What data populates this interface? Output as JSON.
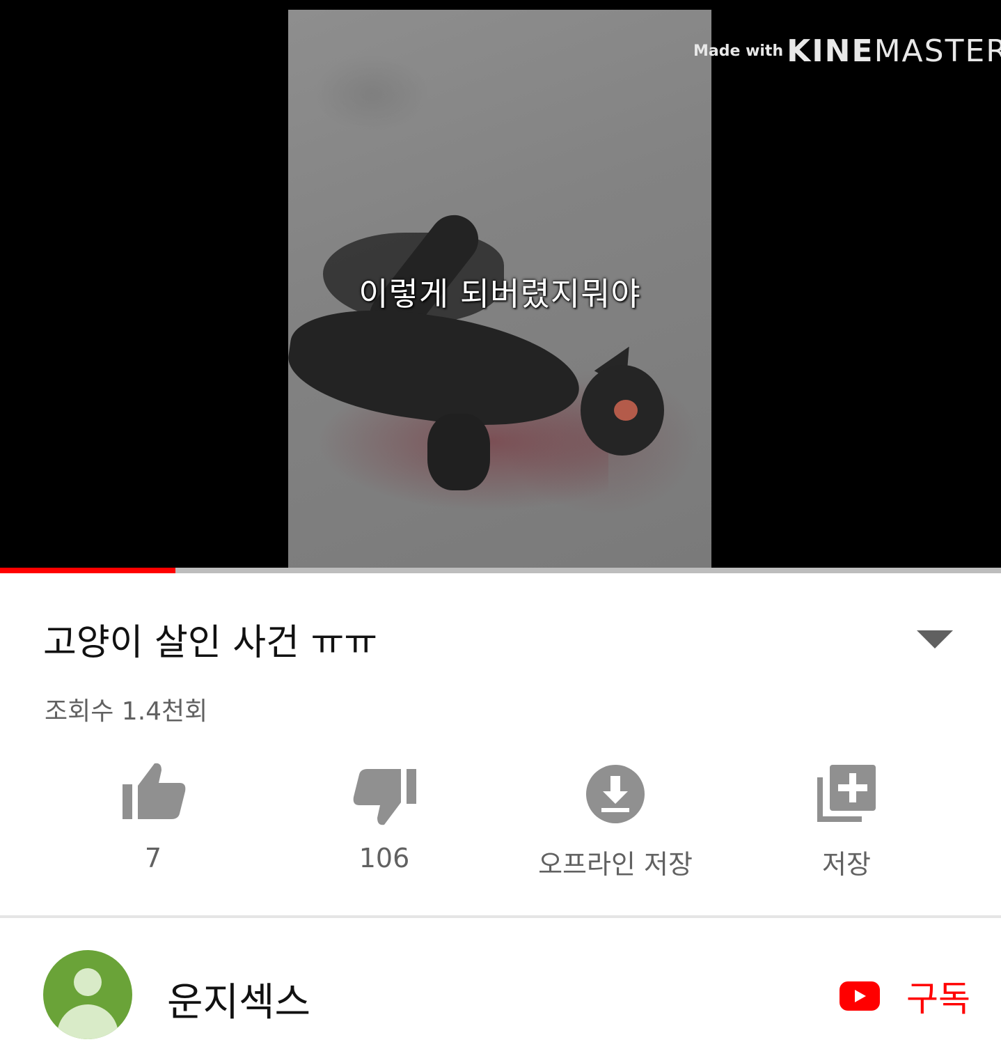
{
  "video": {
    "subtitle": "이렇게 되버렸지뭐야",
    "watermark_small": "Made with",
    "watermark_bold": "KINE",
    "watermark_rest": "MASTER",
    "progress_fraction": 0.175
  },
  "info": {
    "title": "고양이 살인 사건 ㅠㅠ",
    "views": "조회수 1.4천회"
  },
  "actions": {
    "like_count": "7",
    "dislike_count": "106",
    "download_label": "오프라인 저장",
    "save_label": "저장"
  },
  "channel": {
    "name": "운지섹스",
    "subscribe_label": "구독"
  },
  "colors": {
    "accent": "#ff0000",
    "icon_gray": "#909090",
    "avatar_bg": "#6aa338"
  }
}
